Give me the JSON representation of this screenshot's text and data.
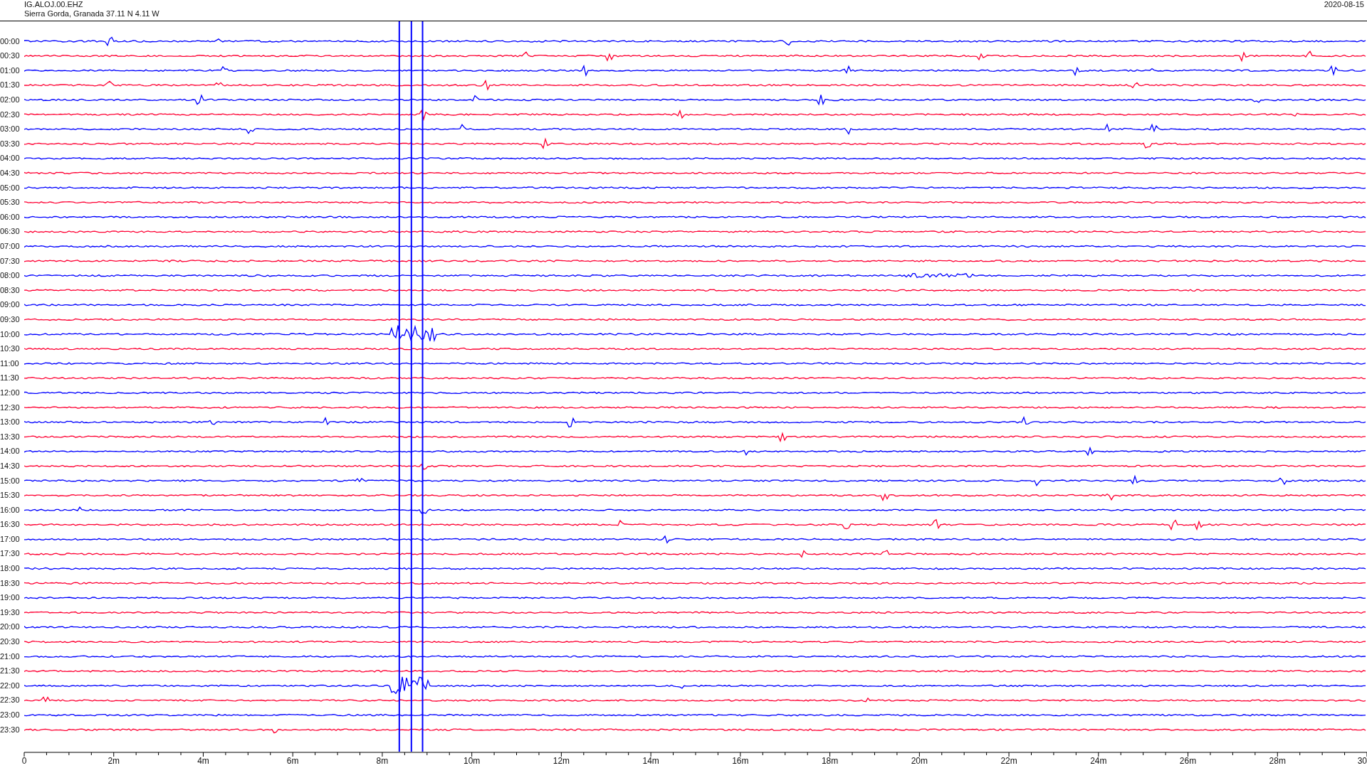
{
  "header": {
    "station": "IG.ALOJ.00.EHZ",
    "location": "Sierra Gorda, Granada  37.11 N 4.11 W",
    "date": "2020-08-15"
  },
  "rows": [
    {
      "label": "00:00",
      "color": "#0000ff"
    },
    {
      "label": "00:30",
      "color": "#ff0033"
    },
    {
      "label": "01:00",
      "color": "#0000ff"
    },
    {
      "label": "01:30",
      "color": "#ff0033"
    },
    {
      "label": "02:00",
      "color": "#0000ff"
    },
    {
      "label": "02:30",
      "color": "#ff0033"
    },
    {
      "label": "03:00",
      "color": "#0000ff"
    },
    {
      "label": "03:30",
      "color": "#ff0033"
    },
    {
      "label": "04:00",
      "color": "#0000ff"
    },
    {
      "label": "04:30",
      "color": "#ff0033"
    },
    {
      "label": "05:00",
      "color": "#0000ff"
    },
    {
      "label": "05:30",
      "color": "#ff0033"
    },
    {
      "label": "06:00",
      "color": "#0000ff"
    },
    {
      "label": "06:30",
      "color": "#ff0033"
    },
    {
      "label": "07:00",
      "color": "#0000ff"
    },
    {
      "label": "07:30",
      "color": "#ff0033"
    },
    {
      "label": "08:00",
      "color": "#0000ff"
    },
    {
      "label": "08:30",
      "color": "#ff0033"
    },
    {
      "label": "09:00",
      "color": "#0000ff"
    },
    {
      "label": "09:30",
      "color": "#ff0033"
    },
    {
      "label": "10:00",
      "color": "#0000ff"
    },
    {
      "label": "10:30",
      "color": "#ff0033"
    },
    {
      "label": "11:00",
      "color": "#0000ff"
    },
    {
      "label": "11:30",
      "color": "#ff0033"
    },
    {
      "label": "12:00",
      "color": "#0000ff"
    },
    {
      "label": "12:30",
      "color": "#ff0033"
    },
    {
      "label": "13:00",
      "color": "#0000ff"
    },
    {
      "label": "13:30",
      "color": "#ff0033"
    },
    {
      "label": "14:00",
      "color": "#0000ff"
    },
    {
      "label": "14:30",
      "color": "#ff0033"
    },
    {
      "label": "15:00",
      "color": "#0000ff"
    },
    {
      "label": "15:30",
      "color": "#ff0033"
    },
    {
      "label": "16:00",
      "color": "#0000ff"
    },
    {
      "label": "16:30",
      "color": "#ff0033"
    },
    {
      "label": "17:00",
      "color": "#0000ff"
    },
    {
      "label": "17:30",
      "color": "#ff0033"
    },
    {
      "label": "18:00",
      "color": "#0000ff"
    },
    {
      "label": "18:30",
      "color": "#ff0033"
    },
    {
      "label": "19:00",
      "color": "#0000ff"
    },
    {
      "label": "19:30",
      "color": "#ff0033"
    },
    {
      "label": "20:00",
      "color": "#0000ff"
    },
    {
      "label": "20:30",
      "color": "#ff0033"
    },
    {
      "label": "21:00",
      "color": "#0000ff"
    },
    {
      "label": "21:30",
      "color": "#ff0033"
    },
    {
      "label": "22:00",
      "color": "#0000ff"
    },
    {
      "label": "22:30",
      "color": "#ff0033"
    },
    {
      "label": "23:00",
      "color": "#0000ff"
    },
    {
      "label": "23:30",
      "color": "#ff0033"
    }
  ],
  "axis": {
    "ticks": [
      "0",
      "2m",
      "4m",
      "6m",
      "8m",
      "10m",
      "12m",
      "14m",
      "16m",
      "18m",
      "20m",
      "22m",
      "24m",
      "26m",
      "28m",
      "30"
    ]
  }
}
